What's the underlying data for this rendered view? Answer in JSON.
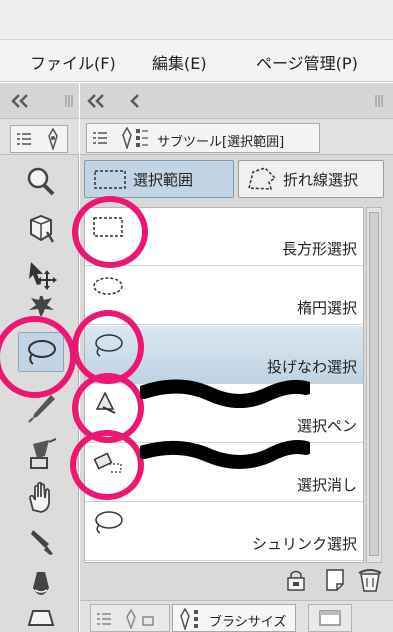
{
  "menu": [
    {
      "label": "ファイル(F)"
    },
    {
      "label": "編集(E)"
    },
    {
      "label": "ページ管理(P)"
    }
  ],
  "panel": {
    "tab_title": "サブツール[選択範囲]"
  },
  "subtabs": [
    {
      "label": "選択範囲",
      "active": true
    },
    {
      "label": "折れ線選択",
      "active": false
    }
  ],
  "subtools": [
    {
      "label": "長方形選択",
      "icon": "rectangle-marquee-icon"
    },
    {
      "label": "楕円選択",
      "icon": "ellipse-marquee-icon"
    },
    {
      "label": "投げなわ選択",
      "icon": "lasso-icon",
      "active": true
    },
    {
      "label": "選択ペン",
      "icon": "selection-pen-icon"
    },
    {
      "label": "選択消し",
      "icon": "selection-eraser-icon"
    },
    {
      "label": "シュリンク選択",
      "icon": "shrink-lasso-icon"
    }
  ],
  "bottom_panel": {
    "tab_title": "ブラシサイズ"
  },
  "colors": {
    "accent_selected": "#c3d4e4",
    "highlight_marker": "#ec1673"
  }
}
